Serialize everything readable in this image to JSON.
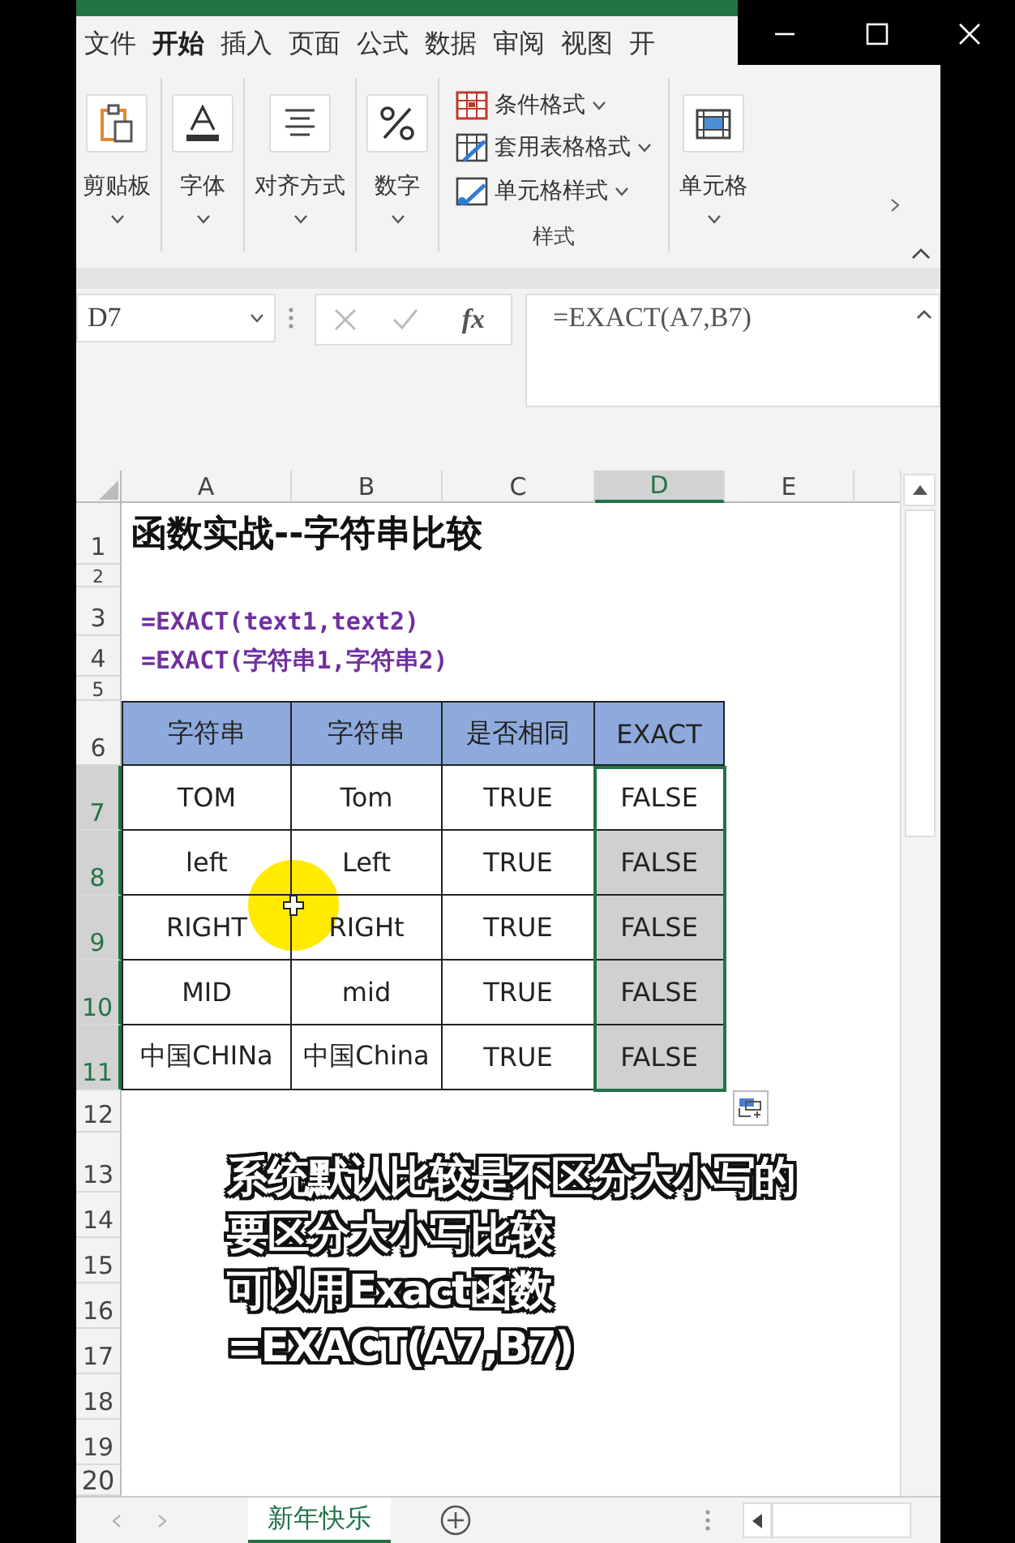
{
  "ribbon_tabs": [
    {
      "label": "文件",
      "selected": false
    },
    {
      "label": "开始",
      "selected": true
    },
    {
      "label": "插入",
      "selected": false
    },
    {
      "label": "页面",
      "selected": false
    },
    {
      "label": "公式",
      "selected": false
    },
    {
      "label": "数据",
      "selected": false
    },
    {
      "label": "审阅",
      "selected": false
    },
    {
      "label": "视图",
      "selected": false
    },
    {
      "label": "开",
      "selected": false
    }
  ],
  "ribbon_groups": [
    {
      "kind": "big",
      "label": "剪贴板"
    },
    {
      "kind": "big",
      "label": "字体"
    },
    {
      "kind": "big",
      "label": "对齐方式"
    },
    {
      "kind": "big",
      "label": "数字"
    },
    {
      "kind": "list",
      "label": "样式",
      "items": [
        {
          "label": "条件格式"
        },
        {
          "label": "套用表格格式"
        },
        {
          "label": "单元格样式"
        }
      ]
    },
    {
      "kind": "big",
      "label": "单元格"
    }
  ],
  "formula_bar": {
    "name_box": "D7",
    "fx_label": "fx",
    "formula": "=EXACT(A7,B7)"
  },
  "columns": [
    {
      "label": "A",
      "selected": false
    },
    {
      "label": "B",
      "selected": false
    },
    {
      "label": "C",
      "selected": false
    },
    {
      "label": "D",
      "selected": true
    },
    {
      "label": "E",
      "selected": false
    }
  ],
  "rows": [
    {
      "label": "1",
      "selected": false
    },
    {
      "label": "2",
      "selected": false
    },
    {
      "label": "3",
      "selected": false
    },
    {
      "label": "4",
      "selected": false
    },
    {
      "label": "5",
      "selected": false
    },
    {
      "label": "6",
      "selected": false
    },
    {
      "label": "7",
      "selected": true
    },
    {
      "label": "8",
      "selected": true
    },
    {
      "label": "9",
      "selected": true
    },
    {
      "label": "10",
      "selected": true
    },
    {
      "label": "11",
      "selected": true
    },
    {
      "label": "12",
      "selected": false
    },
    {
      "label": "13",
      "selected": false
    },
    {
      "label": "14",
      "selected": false
    },
    {
      "label": "15",
      "selected": false
    },
    {
      "label": "16",
      "selected": false
    },
    {
      "label": "17",
      "selected": false
    },
    {
      "label": "18",
      "selected": false
    },
    {
      "label": "19",
      "selected": false
    },
    {
      "label": "20",
      "selected": false
    }
  ],
  "sheet_title": "函数实战--字符串比较",
  "syntax_lines": [
    "=EXACT(text1,text2)",
    "=EXACT(字符串1,字符串2)"
  ],
  "table": {
    "columns": [
      "字符串",
      "字符串",
      "是否相同",
      "EXACT"
    ],
    "rows": [
      {
        "values": [
          "TOM",
          "Tom",
          "TRUE",
          "FALSE"
        ],
        "selected": true,
        "active": true
      },
      {
        "values": [
          "left",
          "Left",
          "TRUE",
          "FALSE"
        ],
        "selected": true,
        "active": false
      },
      {
        "values": [
          "RIGHT",
          "RIGHt",
          "TRUE",
          "FALSE"
        ],
        "selected": true,
        "active": false
      },
      {
        "values": [
          "MID",
          "mid",
          "TRUE",
          "FALSE"
        ],
        "selected": true,
        "active": false
      },
      {
        "values": [
          "中国CHINa",
          "中国China",
          "TRUE",
          "FALSE"
        ],
        "selected": true,
        "active": false
      }
    ]
  },
  "caption_lines": [
    "系统默认比较是不区分大小写的",
    "要区分大小写比较",
    "可以用Exact函数",
    "=EXACT(A7,B7)"
  ],
  "sheet_tabs": [
    {
      "label": "新年快乐",
      "selected": true
    }
  ]
}
